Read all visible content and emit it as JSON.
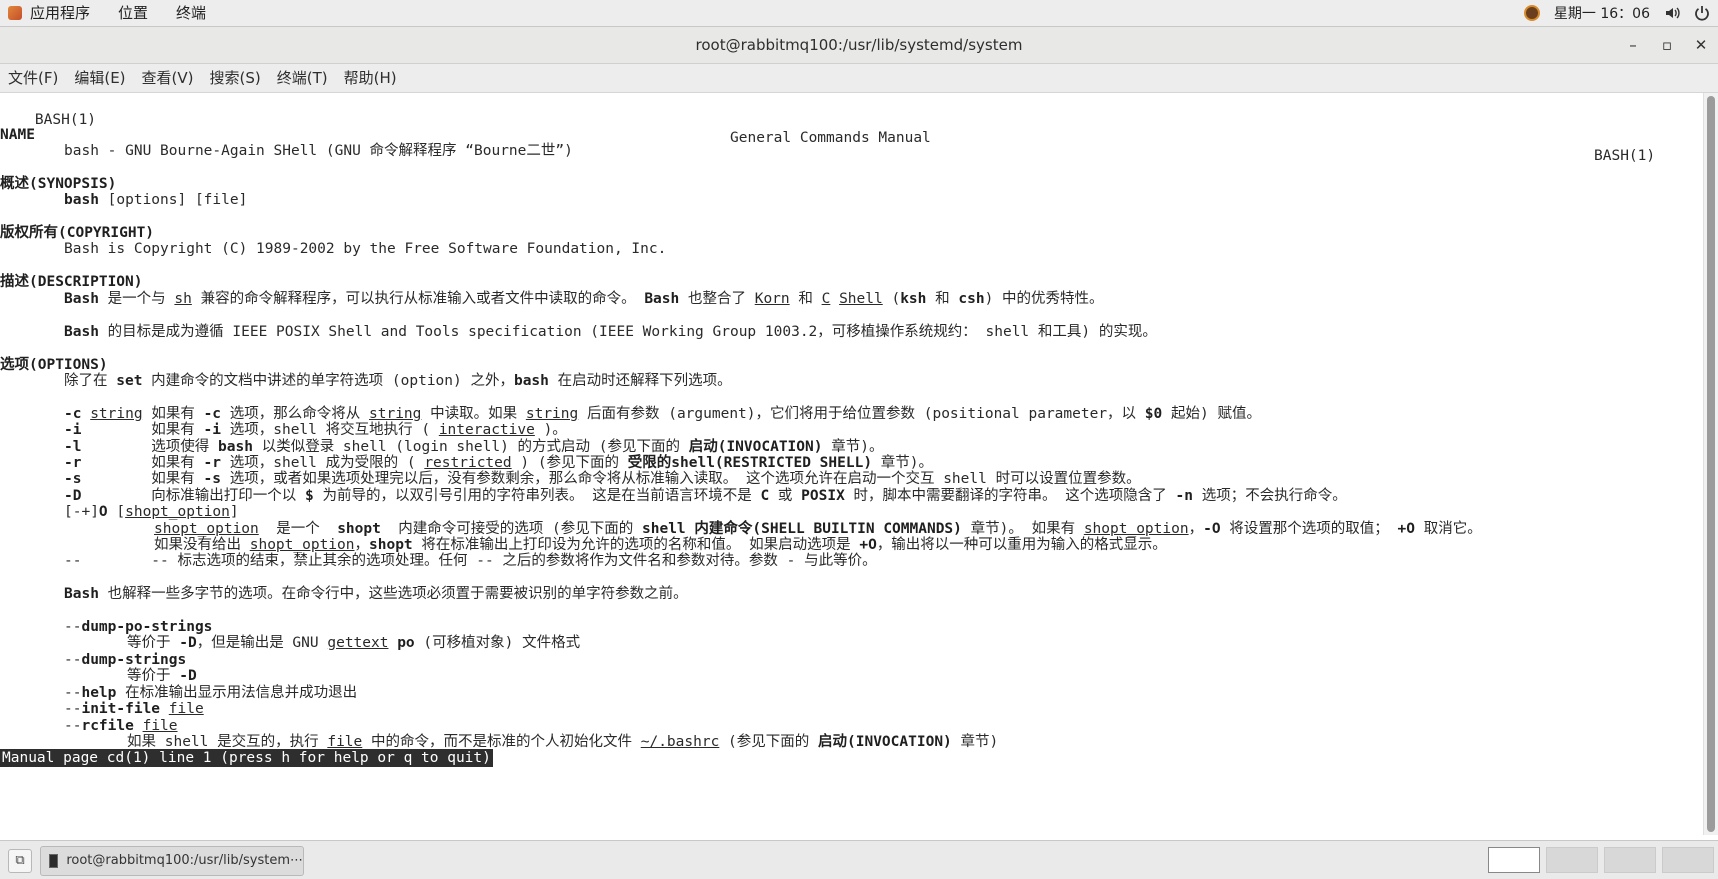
{
  "top_panel": {
    "menu": [
      "应用程序",
      "位置",
      "终端"
    ],
    "clock": "星期一 16：06"
  },
  "window": {
    "title": "root@rabbitmq100:/usr/lib/systemd/system",
    "controls": [
      "–",
      "▫",
      "✕"
    ]
  },
  "menubar": [
    "文件(F)",
    "编辑(E)",
    "查看(V)",
    "搜索(S)",
    "终端(T)",
    "帮助(H)"
  ],
  "man": {
    "header_left": "BASH(1)",
    "header_center": "General Commands Manual",
    "header_right": "BASH(1)",
    "name_heading": "NAME",
    "name_line": "bash - GNU Bourne-Again SHell (GNU 命令解释程序 “Bourne二世”)",
    "synopsis_heading": "概述(SYNOPSIS)",
    "synopsis_cmd": "bash",
    "synopsis_args": " [options] [file]",
    "copyright_heading": "版权所有(COPYRIGHT)",
    "copyright_line": "Bash is Copyright (C) 1989-2002 by the Free Software Foundation, Inc.",
    "description_heading": "描述(DESCRIPTION)",
    "desc1": {
      "bash": "Bash",
      "t1": " 是一个与 ",
      "sh": "sh",
      "t2": " 兼容的命令解释程序，可以执行从标准输入或者文件中读取的命令。 ",
      "bash2": "Bash",
      "t3": " 也整合了 ",
      "korn": "Korn",
      "t4": " 和 ",
      "c": "C",
      "sp": " ",
      "shell": "Shell",
      "t5": " (",
      "ksh": "ksh",
      "t6": " 和 ",
      "csh": "csh",
      "t7": ") 中的优秀特性。"
    },
    "desc2": {
      "bash": "Bash",
      "t1": " 的目标是成为遵循 IEEE POSIX Shell and Tools specification (IEEE Working Group 1003.2，可移植操作系统规约： shell 和工具) 的实现。"
    },
    "options_heading": "选项(OPTIONS)",
    "opt_intro": {
      "t1": "除了在 ",
      "set": "set",
      "t2": " 内建命令的文档中讲述的单字符选项 (option) 之外，",
      "bash": "bash",
      "t3": " 在启动时还解释下列选项。"
    },
    "opt_c": {
      "flag": "-c",
      "sp": " ",
      "arg": "string",
      "t1": " 如果有 ",
      "f2": "-c",
      "t2": " 选项，那么命令将从 ",
      "arg2": "string",
      "t3": " 中读取。如果 ",
      "arg3": "string",
      "t4": " 后面有参数 (argument)，它们将用于给位置参数 (positional parameter，以 ",
      "d0": "$0",
      "t5": " 起始) 赋值。"
    },
    "opt_i": {
      "flag": "-i",
      "t1": "        如果有 ",
      "f2": "-i",
      "t2": " 选项，shell 将交互地执行 ( ",
      "arg": "interactive",
      "t3": " )。"
    },
    "opt_l": {
      "flag": "-l",
      "t1": "        选项使得 ",
      "bash": "bash",
      "t2": " 以类似登录 shell (login shell) 的方式启动 (参见下面的 ",
      "inv": "启动(INVOCATION)",
      "t3": " 章节)。"
    },
    "opt_r": {
      "flag": "-r",
      "t1": "        如果有 ",
      "f2": "-r",
      "t2": " 选项，shell 成为受限的 ( ",
      "arg": "restricted",
      "t3": " ) (参见下面的 ",
      "rs": "受限的shell(RESTRICTED SHELL)",
      "t4": " 章节)。"
    },
    "opt_s": {
      "flag": "-s",
      "t1": "        如果有 ",
      "f2": "-s",
      "t2": " 选项，或者如果选项处理完以后，没有参数剩余，那么命令将从标准输入读取。 这个选项允许在启动一个交互 shell 时可以设置位置参数。"
    },
    "opt_D": {
      "flag": "-D",
      "t1": "        向标准输出打印一个以 ",
      "dollar": "$",
      "t2": " 为前导的，以双引号引用的字符串列表。 这是在当前语言环境不是 ",
      "c": "C",
      "t3": " 或 ",
      "posix": "POSIX",
      "t4": " 时，脚本中需要翻译的字符串。 这个选项隐含了 ",
      "n": "-n",
      "t5": " 选项；不会执行命令。"
    },
    "opt_O": {
      "lead": "[-+]",
      "o": "O",
      "t1": " [",
      "arg": "shopt_option",
      "t2": "]"
    },
    "opt_O_desc1": {
      "arg": "shopt_option",
      "t1": "  是一个  ",
      "shopt": "shopt",
      "t2": "  内建命令可接受的选项 (参见下面的 ",
      "sb": "shell 内建命令(SHELL BUILTIN COMMANDS)",
      "t3": " 章节)。 如果有 ",
      "arg2": "shopt_option",
      "t4": "，",
      "mo": "-O",
      "t5": " 将设置那个选项的取值； ",
      "po": "+O",
      "t6": " 取消它。"
    },
    "opt_O_desc2": {
      "t1": "如果没有给出 ",
      "arg": "shopt_option",
      "t2": "，",
      "shopt": "shopt",
      "t3": " 将在标准输出上打印设为允许的选项的名称和值。 如果启动选项是 ",
      "po": "+O",
      "t4": "，输出将以一种可以重用为输入的格式显示。"
    },
    "opt_dd": {
      "flag": "--",
      "t1": "        -- 标志选项的结束，禁止其余的选项处理。任何 -- 之后的参数将作为文件名和参数对待。参数 - 与此等价。"
    },
    "multi": {
      "bash": "Bash",
      "t1": " 也解释一些多字节的选项。在命令行中，这些选项必须置于需要被识别的单字符参数之前。"
    },
    "dump_po": {
      "dd": "--",
      "name": "dump-po-strings"
    },
    "dump_po_desc": {
      "t1": "等价于 ",
      "d": "-D",
      "t2": "，但是输出是 GNU ",
      "gettext": "gettext",
      "t3": " ",
      "po": "po",
      "t4": " (可移植对象) 文件格式"
    },
    "dump_str": {
      "dd": "--",
      "name": "dump-strings"
    },
    "dump_str_desc": {
      "t1": "等价于 ",
      "d": "-D"
    },
    "help": {
      "dd": "--",
      "name": "help",
      "t1": " 在标准输出显示用法信息并成功退出"
    },
    "initfile": {
      "dd": "--",
      "name": "init-file",
      "sp": " ",
      "arg": "file"
    },
    "rcfile": {
      "dd": "--",
      "name": "rcfile",
      "sp": " ",
      "arg": "file"
    },
    "rcfile_desc": {
      "t1": "如果 shell 是交互的，执行 ",
      "arg": "file",
      "t2": " 中的命令，而不是标准的个人初始化文件 ",
      "bashrc": "~/.bashrc",
      "t3": " (参见下面的 ",
      "inv": "启动(INVOCATION)",
      "t4": " 章节)"
    },
    "status": "Manual page cd(1) line 1 (press h for help or q to quit)"
  },
  "taskbar": {
    "task_label": "root@rabbitmq100:/usr/lib/system⋯"
  }
}
